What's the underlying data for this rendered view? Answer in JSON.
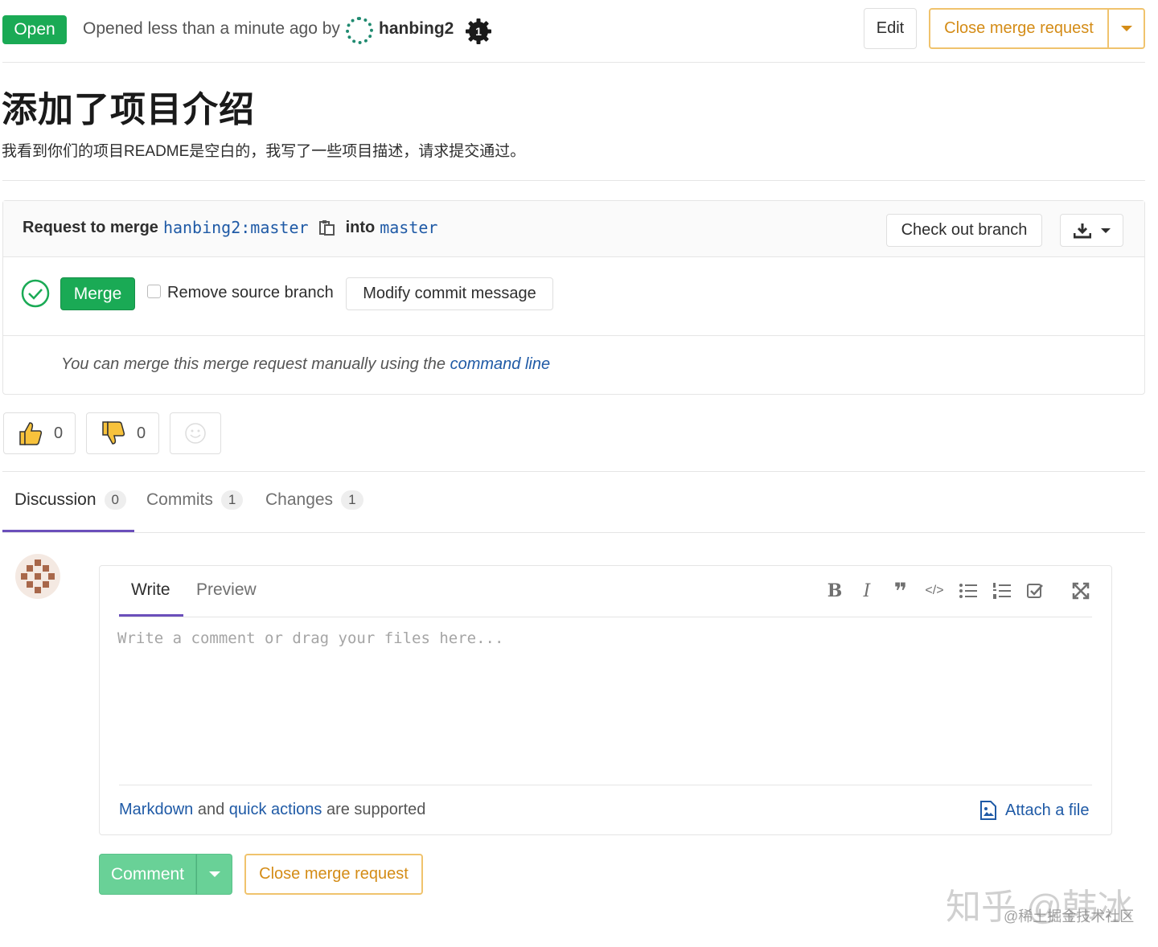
{
  "header": {
    "status": "Open",
    "opened_text": "Opened less than a minute ago by",
    "author": "hanbing2",
    "edit_label": "Edit",
    "close_label": "Close merge request"
  },
  "mr": {
    "title": "添加了项目介绍",
    "description": "我看到你们的项目README是空白的，我写了一些项目描述，请求提交通过。"
  },
  "widget": {
    "request_prefix": "Request to merge",
    "source_branch": "hanbing2:master",
    "into": "into",
    "target_branch": "master",
    "checkout_label": "Check out branch",
    "merge_label": "Merge",
    "remove_source_label": "Remove source branch",
    "modify_commit_label": "Modify commit message",
    "manual_text": "You can merge this merge request manually using the",
    "command_line_link": "command line"
  },
  "awards": {
    "thumbsup_count": "0",
    "thumbsdown_count": "0"
  },
  "tabs": [
    {
      "label": "Discussion",
      "count": "0"
    },
    {
      "label": "Commits",
      "count": "1"
    },
    {
      "label": "Changes",
      "count": "1"
    }
  ],
  "editor": {
    "write_tab": "Write",
    "preview_tab": "Preview",
    "placeholder": "Write a comment or drag your files here...",
    "markdown_link": "Markdown",
    "and_text": "and",
    "quick_actions_link": "quick actions",
    "supported_text": "are supported",
    "attach_label": "Attach a file",
    "tools": [
      "bold-icon",
      "italic-icon",
      "quote-icon",
      "code-icon",
      "bullet-list-icon",
      "numbered-list-icon",
      "task-list-icon",
      "fullscreen-icon"
    ]
  },
  "actions": {
    "comment_label": "Comment",
    "close_label": "Close merge request"
  },
  "watermark": {
    "main": "知乎 @韩冰",
    "sub": "@稀土掘金技术社区"
  },
  "colors": {
    "open_green": "#1aaa55",
    "warning_orange": "#d48c17",
    "link_blue": "#1f5aa6",
    "tab_active": "#6b4fbb"
  }
}
